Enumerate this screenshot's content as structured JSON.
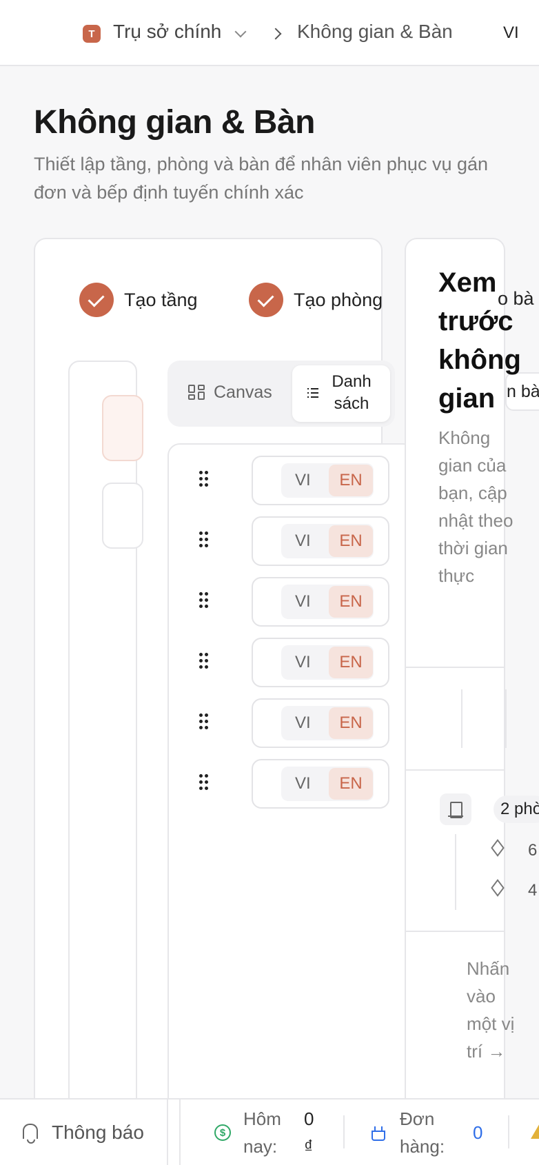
{
  "topbar": {
    "tenant_initial": "T",
    "tenant_name": "Trụ sở chính",
    "breadcrumb_current": "Không gian & Bàn",
    "language": "VI"
  },
  "page": {
    "title": "Không gian & Bàn",
    "subtitle": "Thiết lập tầng, phòng và bàn để nhân viên phục vụ gán đơn và bếp định tuyến chính xác"
  },
  "steps": [
    {
      "label": "Tạo tầng",
      "done": true
    },
    {
      "label": "Tạo phòng",
      "done": true
    },
    {
      "label": "o bà"
    }
  ],
  "view_toggle": {
    "canvas_label": "Canvas",
    "list_label": "Danh sách",
    "overflow_label": "n bà"
  },
  "rows": [
    {
      "vi": "VI",
      "en": "EN"
    },
    {
      "vi": "VI",
      "en": "EN"
    },
    {
      "vi": "VI",
      "en": "EN"
    },
    {
      "vi": "VI",
      "en": "EN"
    },
    {
      "vi": "VI",
      "en": "EN"
    },
    {
      "vi": "VI",
      "en": "EN"
    }
  ],
  "preview": {
    "title": "Xem trước không gian",
    "description": "Không gian của bạn, cập nhật theo thời gian thực",
    "rooms_pill": "2 phò",
    "layer_values": [
      "6",
      "4"
    ],
    "hint": "Nhấn vào một vị trí →"
  },
  "bottombar": {
    "notifications": "Thông báo",
    "today_label": "Hôm nay:",
    "today_value": "0 ₫",
    "orders_label": "Đơn hàng:",
    "orders_value": "0"
  },
  "colors": {
    "accent": "#c8664a",
    "accent_soft": "#f6e3dd",
    "money": "#2fa866",
    "orders": "#2f6ee8",
    "warning": "#e2b13a"
  }
}
